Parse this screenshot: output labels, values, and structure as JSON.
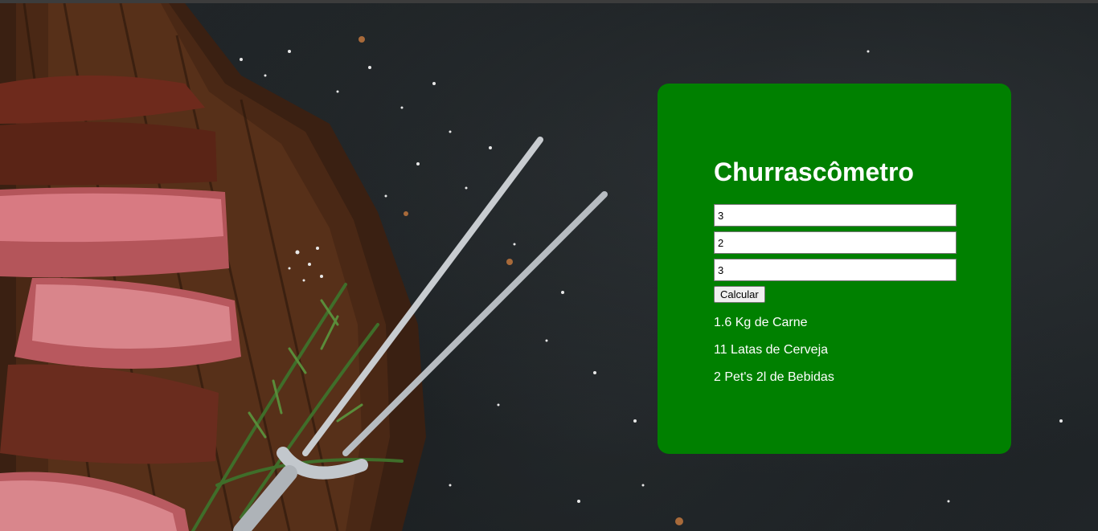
{
  "title": "Churrascômetro",
  "inputs": [
    {
      "value": "3"
    },
    {
      "value": "2"
    },
    {
      "value": "3"
    }
  ],
  "calculate_label": "Calcular",
  "results": [
    "1.6 Kg de Carne",
    "11 Latas de Cerveja",
    "2 Pet's 2l de Bebidas"
  ],
  "colors": {
    "card_background": "#008000",
    "text": "#ffffff",
    "page_background": "#1b1f21"
  }
}
